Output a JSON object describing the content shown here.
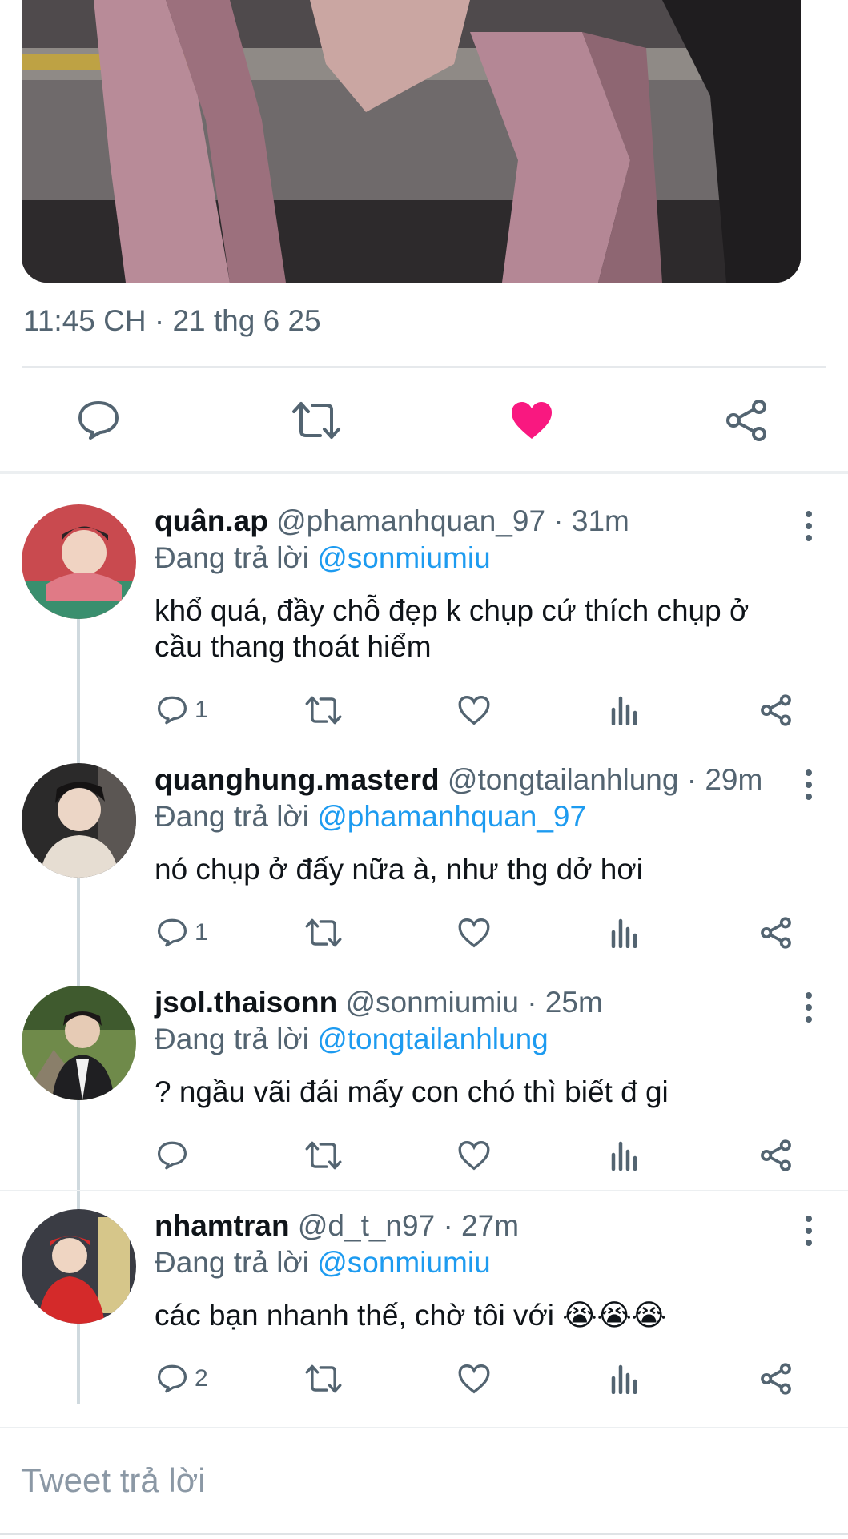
{
  "tweet": {
    "timestamp": "11:45 CH · 21 thg 6 25"
  },
  "colors": {
    "like": "#f91880",
    "mention": "#1d9bf0",
    "muted": "#536471"
  },
  "icons": {
    "reply": "reply-icon",
    "retweet": "retweet-icon",
    "like": "heart-filled-icon",
    "share": "share-icon",
    "views": "views-icon",
    "more": "more-icon"
  },
  "replies": [
    {
      "name": "quân.ap",
      "meta": "@phamanhquan_97 · 31m",
      "replying_label": "Đang trả lời",
      "mention": "@sonmiumiu",
      "text": "khổ quá, đầy chỗ đẹp k chụp cứ thích chụp ở cầu thang thoát hiểm",
      "reply_count": "1"
    },
    {
      "name": "quanghung.masterd",
      "meta": "@tongtailanhlung · 29m",
      "replying_label": "Đang trả lời",
      "mention": "@phamanhquan_97",
      "text": "nó chụp ở đấy nữa à, như thg dở hơi",
      "reply_count": "1"
    },
    {
      "name": "jsol.thaisonn",
      "meta": "@sonmiumiu · 25m",
      "replying_label": "Đang trả lời",
      "mention": "@tongtailanhlung",
      "text": "? ngầu vãi đái mấy con chó thì biết đ gi",
      "reply_count": ""
    },
    {
      "name": "nhamtran",
      "meta": "@d_t_n97 · 27m",
      "replying_label": "Đang trả lời",
      "mention": "@sonmiumiu",
      "text": "các bạn nhanh thế, chờ tôi với 😭😭😭",
      "reply_count": "2"
    }
  ],
  "composer": {
    "placeholder": "Tweet trả lời"
  }
}
